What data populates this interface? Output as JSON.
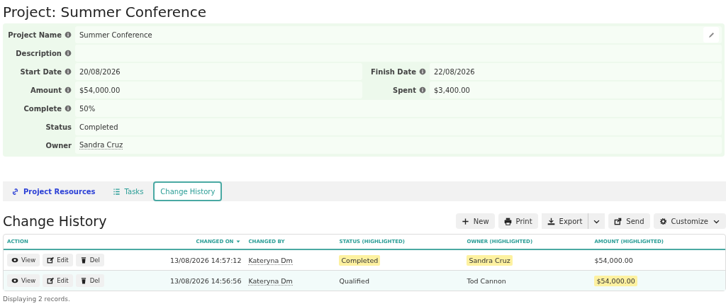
{
  "page_title": "Project: Summer Conference",
  "form": {
    "rows": [
      {
        "fields": [
          {
            "label": "Project Name",
            "info": true,
            "value": "Summer Conference",
            "kind": "text"
          }
        ]
      },
      {
        "fields": [
          {
            "label": "Description",
            "info": true
          }
        ]
      },
      {
        "fields": [
          {
            "label": "Start Date",
            "info": true,
            "value": "20/08/2026",
            "kind": "text"
          },
          {
            "label": "Finish Date",
            "info": true,
            "value": "22/08/2026",
            "kind": "text"
          }
        ]
      },
      {
        "fields": [
          {
            "label": "Amount",
            "info": true,
            "value": "$54,000.00",
            "kind": "text"
          },
          {
            "label": "Spent",
            "info": true,
            "value": "$3,400.00",
            "kind": "text"
          }
        ]
      },
      {
        "fields": [
          {
            "label": "Complete",
            "info": true,
            "value": "50%",
            "kind": "text"
          }
        ]
      },
      {
        "fields": [
          {
            "label": "Status",
            "info": false,
            "value": "Completed",
            "kind": "text"
          }
        ]
      },
      {
        "fields": [
          {
            "label": "Owner",
            "info": false,
            "value": "Sandra Cruz",
            "kind": "link"
          }
        ]
      }
    ]
  },
  "tabs": [
    {
      "label": "Project Resources",
      "selected": false
    },
    {
      "label": "Tasks",
      "selected": false
    },
    {
      "label": "Change History",
      "selected": true
    }
  ],
  "section_title": "Change History",
  "toolbar": [
    {
      "label": "New",
      "kind": "button"
    },
    {
      "label": "Print",
      "kind": "button"
    },
    {
      "label": "Export",
      "kind": "split"
    },
    {
      "label": "Send",
      "kind": "button"
    },
    {
      "label": "Customize",
      "kind": "menu"
    }
  ],
  "table": {
    "columns": [
      {
        "label": "ACTION",
        "sorted": false
      },
      {
        "label": "CHANGED ON",
        "sorted": true
      },
      {
        "label": "CHANGED BY",
        "sorted": false
      },
      {
        "label": "STATUS (HIGHLIGHTED)",
        "sorted": false
      },
      {
        "label": "OWNER (HIGHLIGHTED)",
        "sorted": false
      },
      {
        "label": "AMOUNT (HIGHLIGHTED)",
        "sorted": false
      }
    ],
    "rows": [
      {
        "actions": [
          "View",
          "Edit",
          "Del"
        ],
        "changed_on": "13/08/2026 14:57:12",
        "changed_by": "Kateryna Dm",
        "status": {
          "text": "Completed",
          "highlighted": true
        },
        "owner": {
          "text": "Sandra Cruz",
          "highlighted": true
        },
        "amount": {
          "text": "$54,000.00",
          "highlighted": false
        }
      },
      {
        "actions": [
          "View",
          "Edit",
          "Del"
        ],
        "changed_on": "13/08/2026 14:56:56",
        "changed_by": "Kateryna Dm",
        "status": {
          "text": "Qualified",
          "highlighted": false
        },
        "owner": {
          "text": "Tod Cannon",
          "highlighted": false
        },
        "amount": {
          "text": "$54,000.00",
          "highlighted": true
        }
      }
    ]
  },
  "footer": "Displaying 2 records."
}
